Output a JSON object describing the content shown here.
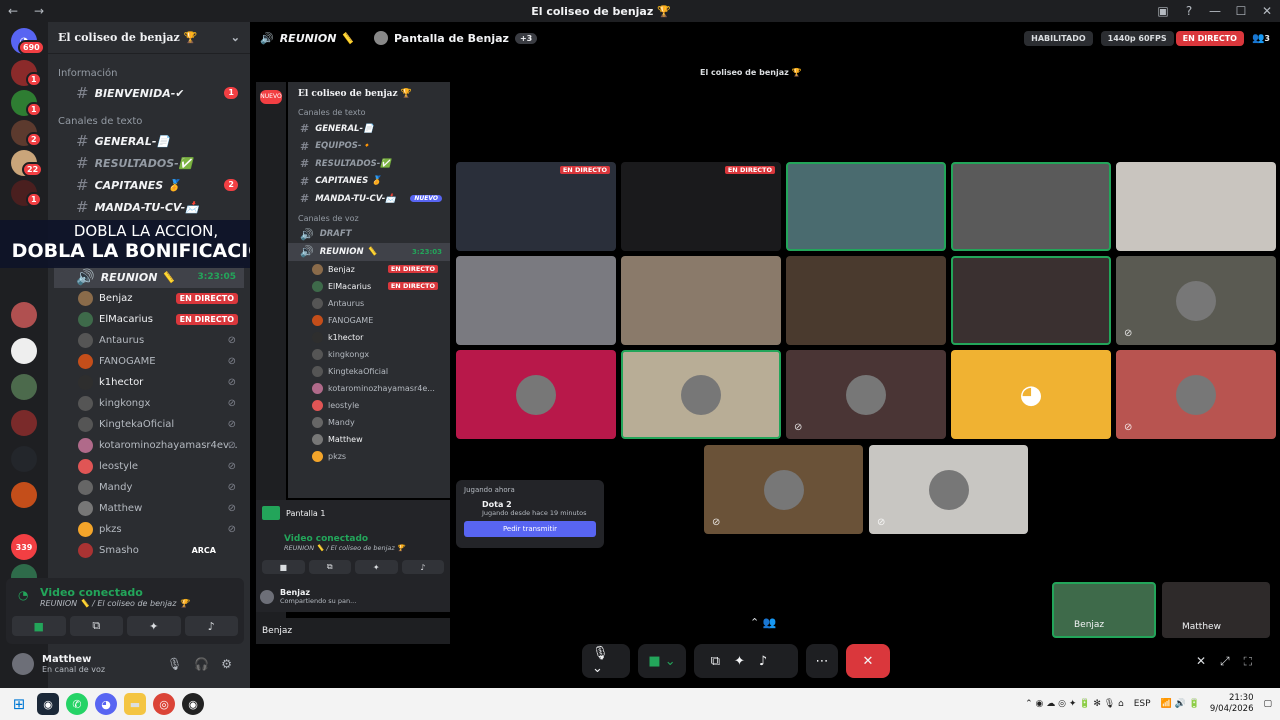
{
  "window": {
    "title": "El coliseo de benjaz 🏆"
  },
  "guild_badges": [
    "690",
    "1",
    "1",
    "2",
    "22",
    "1"
  ],
  "sidebar": {
    "server_name": "El coliseo de benjaz 🏆",
    "cat_info": "Información",
    "cat_text": "Canales de texto",
    "channels": [
      {
        "name": "BIENVENIDA-✔",
        "count": "1"
      },
      {
        "name": "GENERAL-📄",
        "count": ""
      },
      {
        "name": "RESULTADOS-✅",
        "count": ""
      },
      {
        "name": "CAPITANES 🏅",
        "count": "2"
      },
      {
        "name": "MANDA-TU-CV-📩",
        "count": ""
      }
    ],
    "voice_channel": "REUNION 📏",
    "voice_time": "3:23:05",
    "voice_users": [
      {
        "name": "Benjaz",
        "live": "EN DIRECTO"
      },
      {
        "name": "ElMacarius",
        "live": "EN DIRECTO"
      },
      {
        "name": "Antaurus",
        "live": ""
      },
      {
        "name": "FANOGAME",
        "live": ""
      },
      {
        "name": "k1hector",
        "live": ""
      },
      {
        "name": "kingkongx",
        "live": ""
      },
      {
        "name": "KingtekaOficial",
        "live": ""
      },
      {
        "name": "kotarominozhayamasr4ev...",
        "live": ""
      },
      {
        "name": "leostyle",
        "live": ""
      },
      {
        "name": "Mandy",
        "live": ""
      },
      {
        "name": "Matthew",
        "live": ""
      },
      {
        "name": "pkzs",
        "live": ""
      },
      {
        "name": "Smasho",
        "live": "ARCA"
      }
    ]
  },
  "promo": {
    "line1": "DOBLA LA ACCION,",
    "line2": "DOBLA LA BONIFICACION"
  },
  "voice_panel": {
    "title": "Video conectado",
    "sub": "REUNION 📏 / El coliseo de benjaz 🏆"
  },
  "user": {
    "name": "Matthew",
    "status": "En canal de voz"
  },
  "stage": {
    "channel": "REUNION 📏",
    "screen": "Pantalla de Benjaz",
    "extra": "+3",
    "enabled": "HABILITADO",
    "quality": "1440p 60FPS",
    "live": "EN DIRECTO",
    "count": "3"
  },
  "inner": {
    "title": "El coliseo de benjaz 🏆",
    "server": "El coliseo de benjaz 🏆",
    "cat_text": "Canales de texto",
    "cat_voice": "Canales de voz",
    "new_badge": "NUEVO",
    "channels": [
      {
        "name": "GENERAL-📄"
      },
      {
        "name": "EQUIPOS-🔸"
      },
      {
        "name": "RESULTADOS-✅"
      },
      {
        "name": "CAPITANES 🏅"
      },
      {
        "name": "MANDA-TU-CV-📩"
      }
    ],
    "draft": "DRAFT",
    "voice": "REUNION 📏",
    "voice_time": "3:23:03",
    "users": [
      {
        "name": "Benjaz",
        "live": "EN DIRECTO"
      },
      {
        "name": "ElMacarius",
        "live": "EN DIRECTO"
      },
      {
        "name": "Antaurus",
        "live": ""
      },
      {
        "name": "FANOGAME",
        "live": ""
      },
      {
        "name": "k1hector",
        "live": ""
      },
      {
        "name": "kingkongx",
        "live": ""
      },
      {
        "name": "KingtekaOficial",
        "live": ""
      },
      {
        "name": "kotarominozhayamasr4e...",
        "live": ""
      },
      {
        "name": "leostyle",
        "live": ""
      },
      {
        "name": "Mandy",
        "live": ""
      },
      {
        "name": "Matthew",
        "live": ""
      },
      {
        "name": "pkzs",
        "live": ""
      }
    ],
    "screen_title": "Pantalla 1",
    "vc_title": "Video conectado",
    "vc_sub": "REUNION 📏 / El coliseo de benjaz 🏆",
    "user": "Benjaz",
    "user_status": "Compartiendo su pan...",
    "taskbar_user": "Benjaz"
  },
  "playing": {
    "label": "Jugando ahora",
    "game": "Dota 2",
    "since": "Jugando desde hace 19 minutos",
    "button": "Pedir transmitir"
  },
  "tiles": [
    "EN DIRECTO",
    "EN DIRECTO"
  ],
  "thumbs": [
    "Benjaz",
    "Matthew"
  ],
  "taskbar": {
    "lang": "ESP",
    "time": "21:30",
    "date": "9/04/2026"
  },
  "colors": {
    "brand": "#5865f2",
    "live": "#da373c",
    "green": "#23a55a"
  }
}
